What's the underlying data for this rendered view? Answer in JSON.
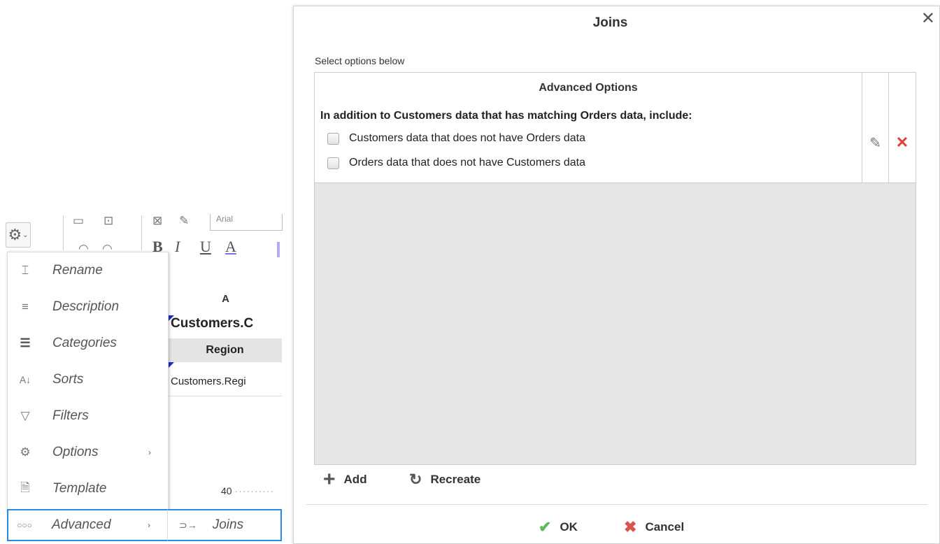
{
  "toolbar": {
    "font_name": "Arial",
    "bold": "B",
    "italic": "I",
    "underline": "U",
    "font_color": "A"
  },
  "sheet": {
    "column_header": "A",
    "title_cell": "Customers.C",
    "region_header": "Region",
    "field_cell": "Customers.Regi",
    "axis_value": "40"
  },
  "menu": {
    "items": [
      {
        "label": "Rename",
        "icon": "rename-icon"
      },
      {
        "label": "Description",
        "icon": "description-icon"
      },
      {
        "label": "Categories",
        "icon": "categories-icon"
      },
      {
        "label": "Sorts",
        "icon": "sort-az-icon"
      },
      {
        "label": "Filters",
        "icon": "filter-icon"
      },
      {
        "label": "Options",
        "icon": "options-gear-icon"
      },
      {
        "label": "Template",
        "icon": "template-icon"
      }
    ],
    "advanced_label": "Advanced",
    "submenu_label": "Joins"
  },
  "dialog": {
    "title": "Joins",
    "subtitle": "Select options below",
    "grid_header": "Advanced Options",
    "row_heading": "In addition to Customers data that has matching Orders data, include:",
    "options": [
      {
        "label": "Customers data that does not have Orders data",
        "checked": false
      },
      {
        "label": "Orders data that does not have Customers data",
        "checked": false
      }
    ],
    "add_label": "Add",
    "recreate_label": "Recreate",
    "ok_label": "OK",
    "cancel_label": "Cancel"
  },
  "colors": {
    "accent_blue": "#2a89e5",
    "ok_green": "#5cb85c",
    "cancel_red": "#d9534f",
    "delete_red": "#e0403a",
    "grid_bg": "#e6e6e6"
  }
}
